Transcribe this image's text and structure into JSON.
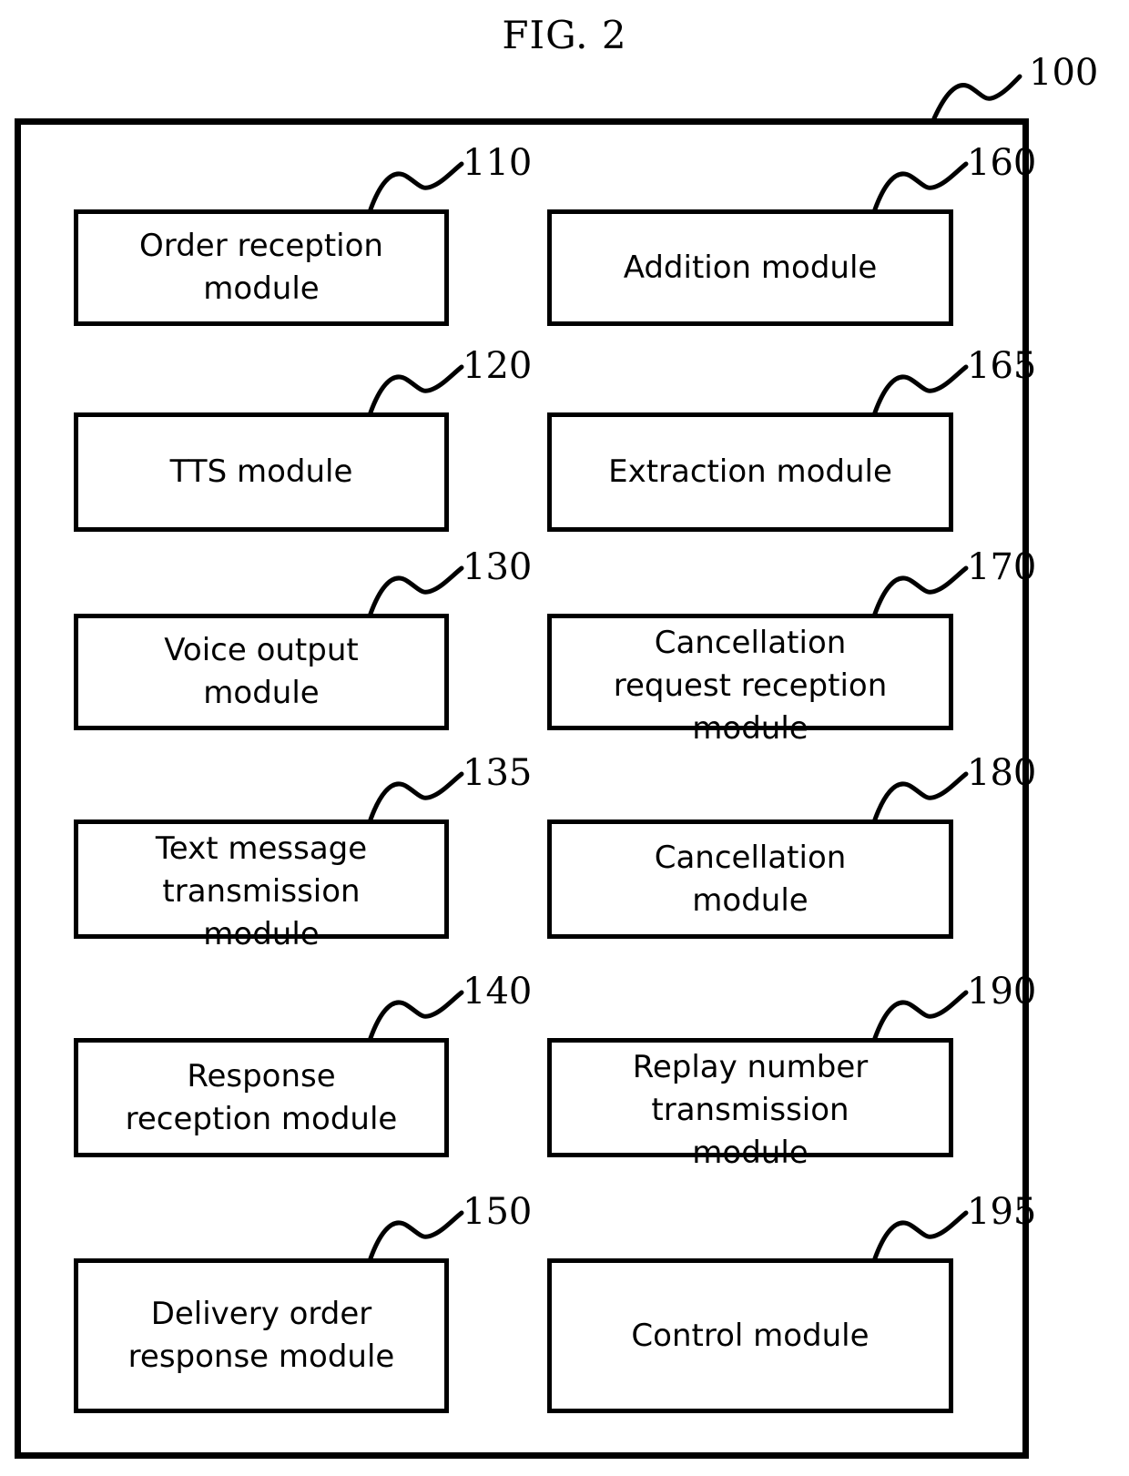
{
  "figure": {
    "title": "FIG. 2",
    "system_ref": "100"
  },
  "modules": [
    {
      "ref": "110",
      "label": "Order reception\nmodule",
      "column": "left",
      "row": 1,
      "overflow": false
    },
    {
      "ref": "120",
      "label": "TTS module",
      "column": "left",
      "row": 2,
      "overflow": false
    },
    {
      "ref": "130",
      "label": "Voice output\nmodule",
      "column": "left",
      "row": 3,
      "overflow": false
    },
    {
      "ref": "135",
      "label": "Text message\ntransmission\nmodule",
      "column": "left",
      "row": 4,
      "overflow": true
    },
    {
      "ref": "140",
      "label": "Response\nreception module",
      "column": "left",
      "row": 5,
      "overflow": false
    },
    {
      "ref": "150",
      "label": "Delivery order\nresponse module",
      "column": "left",
      "row": 6,
      "overflow": false
    },
    {
      "ref": "160",
      "label": "Addition module",
      "column": "right",
      "row": 1,
      "overflow": false
    },
    {
      "ref": "165",
      "label": "Extraction module",
      "column": "right",
      "row": 2,
      "overflow": false
    },
    {
      "ref": "170",
      "label": "Cancellation\nrequest reception\nmodule",
      "column": "right",
      "row": 3,
      "overflow": true
    },
    {
      "ref": "180",
      "label": "Cancellation\nmodule",
      "column": "right",
      "row": 4,
      "overflow": false
    },
    {
      "ref": "190",
      "label": "Replay number\ntransmission\nmodule",
      "column": "right",
      "row": 5,
      "overflow": true
    },
    {
      "ref": "195",
      "label": "Control module",
      "column": "right",
      "row": 6,
      "overflow": false
    }
  ],
  "colors": {
    "line": "#000000",
    "background": "#ffffff"
  }
}
